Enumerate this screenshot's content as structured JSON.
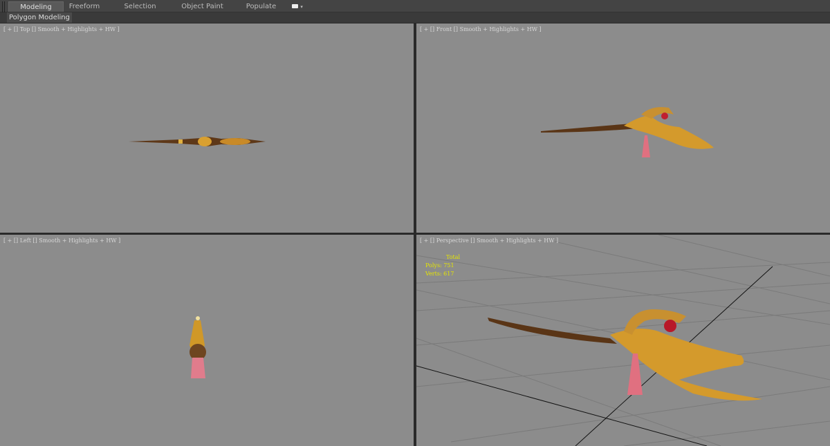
{
  "ribbon": {
    "tabs": [
      "Modeling",
      "Freeform",
      "Selection",
      "Object Paint",
      "Populate"
    ],
    "active": "Modeling",
    "extra_icon": "ribbon-options-icon"
  },
  "sub_panel": "Polygon Modeling",
  "viewports": {
    "top": "[ + [] Top [] Smooth + Highlights + HW ]",
    "front": "[ + [] Front [] Smooth + Highlights + HW ]",
    "left": "[ + [] Left [] Smooth + Highlights + HW ]",
    "perspective": "[ + [] Perspective [] Smooth + Highlights + HW ]"
  },
  "stats": {
    "header": "Total",
    "polys_label": "Polys:",
    "polys": "751",
    "verts_label": "Verts:",
    "verts": "617"
  }
}
